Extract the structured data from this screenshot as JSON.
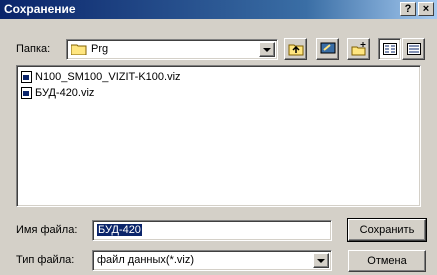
{
  "window": {
    "title": "Сохранение",
    "help_label": "?",
    "close_label": "×"
  },
  "folder": {
    "label": "Папка:",
    "current": "Prg"
  },
  "toolbar": {
    "up_icon": "up-folder-icon",
    "desktop_icon": "desktop-icon",
    "new_folder_icon": "new-folder-icon",
    "list_view_icon": "list-view-icon",
    "details_view_icon": "details-view-icon"
  },
  "files": [
    {
      "name": "N100_SM100_VIZIT-K100.viz"
    },
    {
      "name": "БУД-420.viz"
    }
  ],
  "filename": {
    "label": "Имя файла:",
    "value": "БУД-420"
  },
  "filetype": {
    "label": "Тип файла:",
    "value": "файл данных(*.viz)"
  },
  "buttons": {
    "save": "Сохранить",
    "cancel": "Отмена"
  }
}
